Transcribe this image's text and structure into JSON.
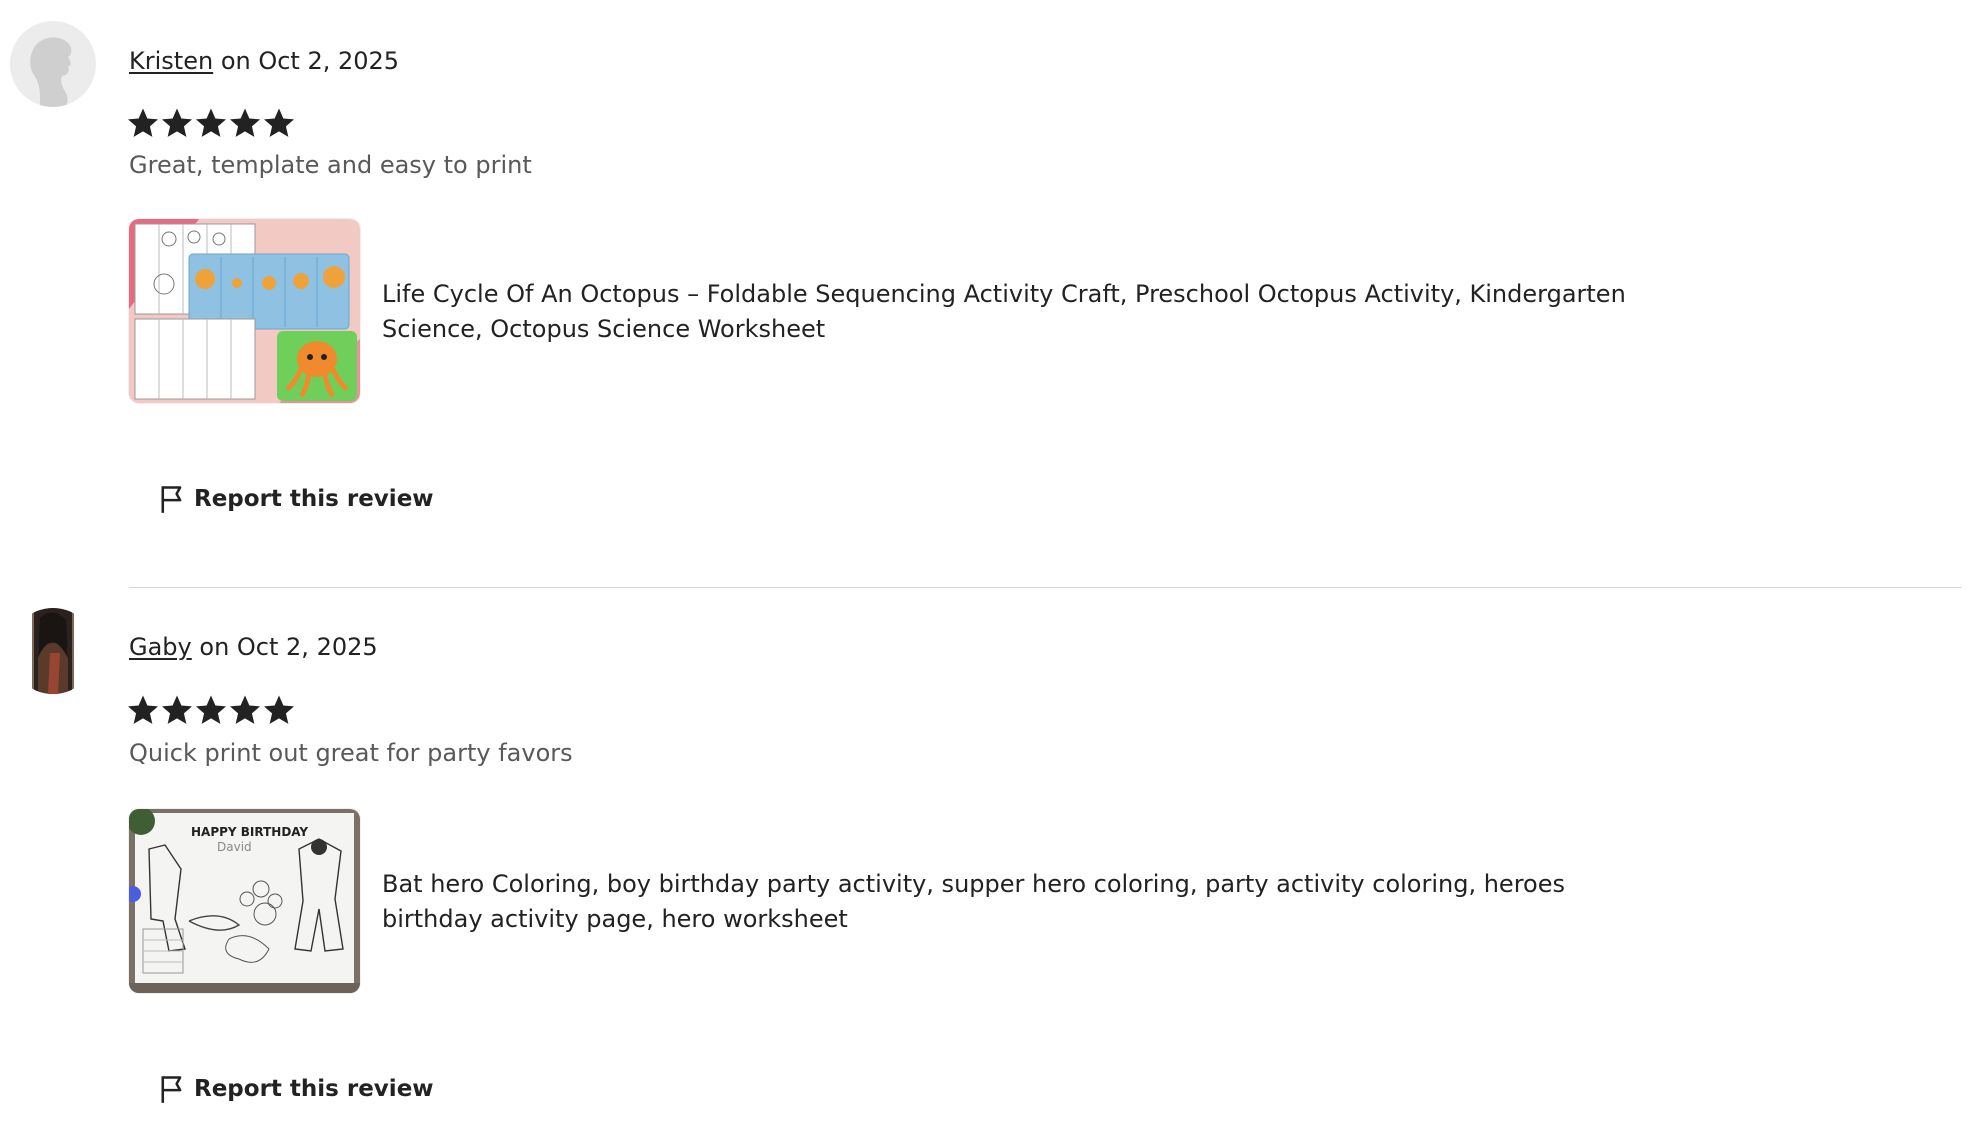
{
  "reviews": [
    {
      "reviewer": "Kristen",
      "date_text": "on Oct 2, 2025",
      "rating": 5,
      "text": "Great, template and easy to print",
      "item_title": "Life Cycle Of An Octopus – Foldable Sequencing Activity Craft, Preschool Octopus Activity, Kindergarten Science, Octopus Science Worksheet",
      "report_label": "Report this review",
      "avatar_icon": "default-user-silhouette-icon"
    },
    {
      "reviewer": "Gaby",
      "date_text": "on Oct 2, 2025",
      "rating": 5,
      "text": "Quick print out great for party favors",
      "item_title": "Bat hero Coloring, boy birthday party activity, supper hero coloring, party activity coloring, heroes birthday activity page, hero worksheet",
      "report_label": "Report this review",
      "avatar_icon": "user-photo"
    }
  ],
  "colors": {
    "text": "#222222",
    "muted_text": "#595959",
    "divider": "#d6d6d6",
    "star": "#222222"
  },
  "icons": {
    "star": "star-icon",
    "flag": "flag-icon"
  }
}
